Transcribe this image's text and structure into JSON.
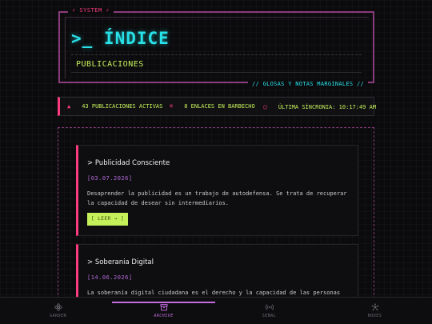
{
  "header": {
    "system_tag": "⚡ SYSTEM ⚡",
    "title": ">_ ÍNDICE",
    "subtitle": "PUBLICACIONES",
    "glosas_tag": "// GLOSAS Y NOTAS MARGINALES //"
  },
  "status": {
    "active_icon": "▲",
    "active": "43 PUBLICACIONES ACTIVAS",
    "links_icon": "⌘",
    "links": "8 ENLACES EN BARBECHO",
    "sync_icon": "○",
    "sync": "ÚLTIMA SÍNCRONIA: 10:17:49 AM"
  },
  "posts": [
    {
      "title": "> Publicidad Consciente",
      "date": "[03.07.2026]",
      "excerpt": "Desaprender la publicidad es un trabajo de autodefensa. Se trata de recuperar la capacidad de desear sin intermediarios.",
      "button": "[ LEER → ]"
    },
    {
      "title": "> Soberania Digital",
      "date": "[14.06.2026]",
      "excerpt": "La soberanía digital ciudadana es el derecho y la capacidad de las personas"
    }
  ],
  "nav": {
    "items": [
      {
        "label": "GARDEN",
        "icon": "flower-icon"
      },
      {
        "label": "ARCHIVE",
        "icon": "archive-box-icon"
      },
      {
        "label": "SEÑAL",
        "icon": "signal-icon"
      },
      {
        "label": "NODES",
        "icon": "nodes-icon"
      }
    ],
    "active": "ARCHIVE"
  },
  "colors": {
    "accent_cyan": "#28e0e8",
    "accent_pink": "#ff3b7f",
    "accent_lime": "#c6f05a",
    "accent_purple": "#c56de0",
    "frame_magenta": "#8a3b7c",
    "background": "#0b0b0d"
  }
}
